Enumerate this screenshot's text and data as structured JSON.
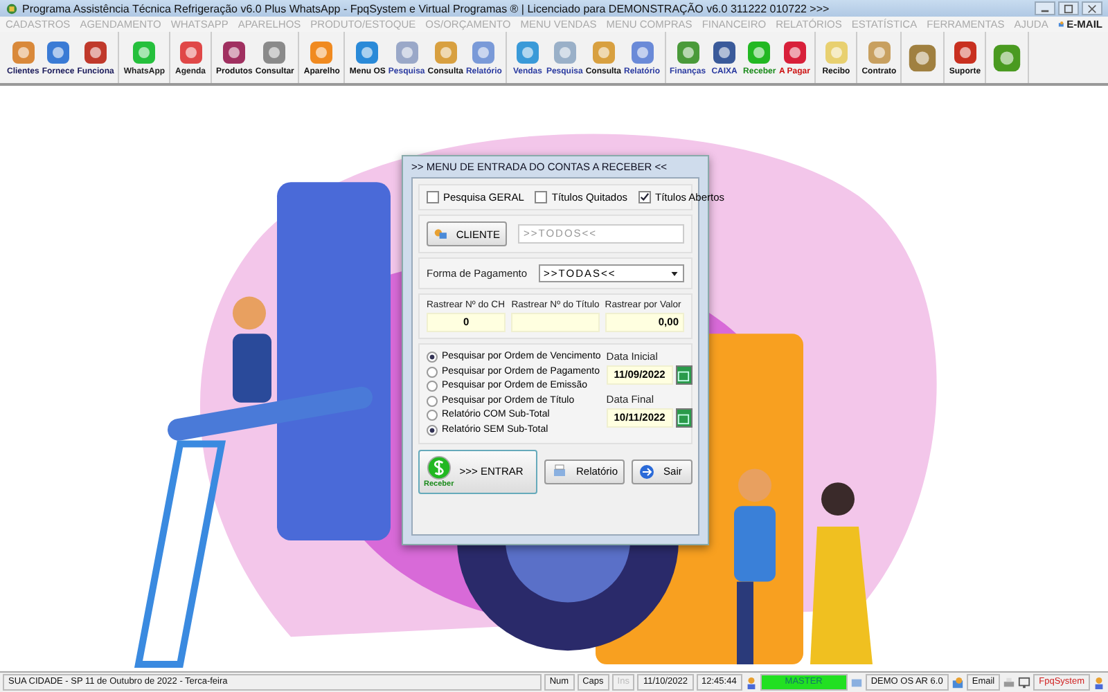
{
  "window": {
    "title": "Programa Assistência Técnica Refrigeração v6.0 Plus WhatsApp - FpqSystem e Virtual Programas ® | Licenciado para  DEMONSTRAÇÃO v6.0 311222 010722 >>>"
  },
  "menu": [
    {
      "label": "CADASTROS",
      "disabled": true
    },
    {
      "label": "AGENDAMENTO",
      "disabled": true
    },
    {
      "label": "WHATSAPP",
      "disabled": true
    },
    {
      "label": "APARELHOS",
      "disabled": true
    },
    {
      "label": "PRODUTO/ESTOQUE",
      "disabled": true
    },
    {
      "label": "OS/ORÇAMENTO",
      "disabled": true
    },
    {
      "label": "MENU VENDAS",
      "disabled": true
    },
    {
      "label": "MENU COMPRAS",
      "disabled": true
    },
    {
      "label": "FINANCEIRO",
      "disabled": true
    },
    {
      "label": "RELATÓRIOS",
      "disabled": true
    },
    {
      "label": "ESTATÍSTICA",
      "disabled": true
    },
    {
      "label": "FERRAMENTAS",
      "disabled": true
    },
    {
      "label": "AJUDA",
      "disabled": true
    },
    {
      "label": "E-MAIL",
      "disabled": false
    }
  ],
  "toolbar": [
    [
      {
        "label": "Clientes",
        "color": "#1a1a5a"
      },
      {
        "label": "Fornece",
        "color": "#1a1a5a"
      },
      {
        "label": "Funciona",
        "color": "#1a1a5a"
      }
    ],
    [
      {
        "label": "WhatsApp",
        "color": "#222222"
      }
    ],
    [
      {
        "label": "Agenda",
        "color": "#222222"
      }
    ],
    [
      {
        "label": "Produtos",
        "color": "#111111"
      },
      {
        "label": "Consultar",
        "color": "#111111"
      }
    ],
    [
      {
        "label": "Aparelho",
        "color": "#111111"
      }
    ],
    [
      {
        "label": "Menu OS",
        "color": "#111111"
      },
      {
        "label": "Pesquisa",
        "color": "#2a3aa0"
      },
      {
        "label": "Consulta",
        "color": "#111111"
      },
      {
        "label": "Relatório",
        "color": "#2a3aa0"
      }
    ],
    [
      {
        "label": "Vendas",
        "color": "#2a3aa0"
      },
      {
        "label": "Pesquisa",
        "color": "#2a3aa0"
      },
      {
        "label": "Consulta",
        "color": "#111111"
      },
      {
        "label": "Relatório",
        "color": "#2a3aa0"
      }
    ],
    [
      {
        "label": "Finanças",
        "color": "#2a3aa0"
      },
      {
        "label": "CAIXA",
        "color": "#2a3aa0"
      },
      {
        "label": "Receber",
        "color": "#1a8a1a"
      },
      {
        "label": "A Pagar",
        "color": "#cc1111"
      }
    ],
    [
      {
        "label": "Recibo",
        "color": "#111111"
      }
    ],
    [
      {
        "label": "Contrato",
        "color": "#111111"
      }
    ],
    [
      {
        "kind": "icon"
      }
    ],
    [
      {
        "label": "Suporte",
        "color": "#111111"
      }
    ],
    [
      {
        "kind": "icon"
      }
    ]
  ],
  "dialog": {
    "title": ">>  MENU DE ENTRADA DO CONTAS A RECEBER  <<",
    "filters": [
      {
        "label": "Pesquisa GERAL",
        "checked": false
      },
      {
        "label": "Títulos Quitados",
        "checked": false
      },
      {
        "label": "Títulos Abertos",
        "checked": true
      }
    ],
    "client_button": "CLIENTE",
    "client_value": ">>TODOS<<",
    "payment_label": "Forma de Pagamento",
    "payment_value": ">>TODAS<<",
    "trackers": [
      {
        "label": "Rastrear Nº do CH",
        "value": "0"
      },
      {
        "label": "Rastrear Nº do Título"
      },
      {
        "label": "Rastrear por Valor",
        "value": "0,00"
      }
    ],
    "orders": [
      {
        "label": "Pesquisar por Ordem de Vencimento",
        "selected": true
      },
      {
        "label": "Pesquisar por Ordem de Pagamento",
        "selected": false
      },
      {
        "label": "Pesquisar por Ordem de Emissão",
        "selected": false
      },
      {
        "label": "Pesquisar por Ordem de Título",
        "selected": false
      }
    ],
    "reports": [
      {
        "label": "Relatório COM Sub-Total",
        "selected": false
      },
      {
        "label": "Relatório SEM Sub-Total",
        "selected": true
      }
    ],
    "dates": [
      {
        "label": "Data Inicial",
        "value": "11/09/2022"
      },
      {
        "label": "Data Final",
        "value": "10/11/2022"
      }
    ],
    "enter_icon_label": "Receber",
    "enter_button": ">>> ENTRAR",
    "report_button": "Relatório",
    "exit_button": "Sair"
  },
  "status_bar": {
    "location": "SUA CIDADE - SP 11 de Outubro de 2022 - Terca-feira",
    "keys": [
      {
        "label": "Num",
        "disabled": false
      },
      {
        "label": "Caps",
        "disabled": false
      },
      {
        "label": "Ins",
        "disabled": true
      }
    ],
    "date": "11/10/2022",
    "time": "12:45:44",
    "user": "MASTER",
    "version": "DEMO OS AR 6.0",
    "email": "Email",
    "brand": "FpqSystem"
  }
}
